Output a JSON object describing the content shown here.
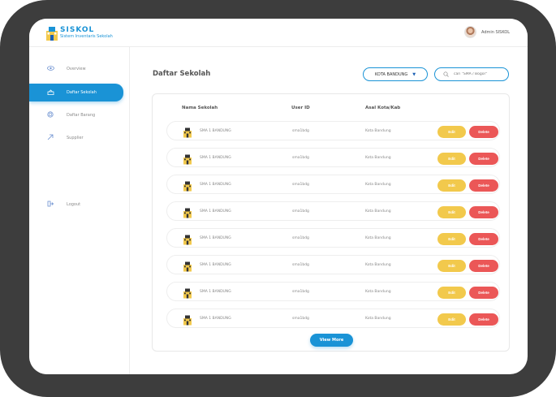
{
  "brand": {
    "title": "SISKOL",
    "subtitle": "Sistem Inventaris Sekolah",
    "logo_icon": "school-building-logo"
  },
  "header": {
    "admin_name": "Admin SISKOL"
  },
  "sidebar": {
    "items": [
      {
        "label": "Overview",
        "icon": "eye-icon",
        "active": false
      },
      {
        "label": "Daftar Sekolah",
        "icon": "school-icon",
        "active": true
      },
      {
        "label": "Daftar Barang",
        "icon": "box-icon",
        "active": false
      },
      {
        "label": "Supplier",
        "icon": "truck-icon",
        "active": false
      },
      {
        "label": "Logout",
        "icon": "logout-icon",
        "active": false
      }
    ]
  },
  "main": {
    "title": "Daftar Sekolah",
    "city_filter": "KOTA BANDUNG",
    "search_placeholder": "cari \"SMA / Bogor\""
  },
  "table": {
    "columns": [
      "Nama Sekolah",
      "User ID",
      "Asal Kota/Kab"
    ],
    "rows": [
      {
        "name": "SMA 1 BANDUNG",
        "user_id": "sma1bdg",
        "city": "Kota Bandung",
        "edit": "Edit",
        "delete": "Delete"
      },
      {
        "name": "SMA 1 BANDUNG",
        "user_id": "sma1bdg",
        "city": "Kota Bandung",
        "edit": "Edit",
        "delete": "Delete"
      },
      {
        "name": "SMA 1 BANDUNG",
        "user_id": "sma1bdg",
        "city": "Kota Bandung",
        "edit": "Edit",
        "delete": "Delete"
      },
      {
        "name": "SMA 1 BANDUNG",
        "user_id": "sma1bdg",
        "city": "Kota Bandung",
        "edit": "Edit",
        "delete": "Delete"
      },
      {
        "name": "SMA 1 BANDUNG",
        "user_id": "sma1bdg",
        "city": "Kota Bandung",
        "edit": "Edit",
        "delete": "Delete"
      },
      {
        "name": "SMA 1 BANDUNG",
        "user_id": "sma1bdg",
        "city": "Kota Bandung",
        "edit": "Edit",
        "delete": "Delete"
      },
      {
        "name": "SMA 1 BANDUNG",
        "user_id": "sma1bdg",
        "city": "Kota Bandung",
        "edit": "Edit",
        "delete": "Delete"
      },
      {
        "name": "SMA 1 BANDUNG",
        "user_id": "sma1bdg",
        "city": "Kota Bandung",
        "edit": "Edit",
        "delete": "Delete"
      }
    ],
    "view_more": "View More"
  },
  "colors": {
    "primary": "#1a93d6",
    "edit": "#f2c94c",
    "delete": "#eb5757",
    "frame": "#3d3d3d"
  }
}
